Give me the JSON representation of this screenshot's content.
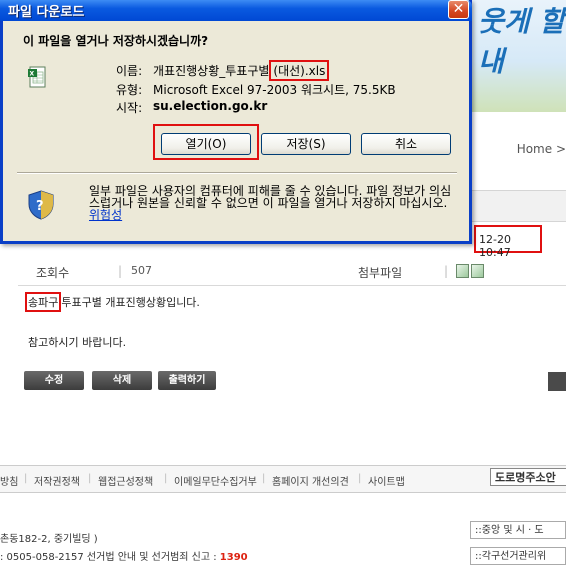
{
  "dialog": {
    "title": "파일 다운로드",
    "question": "이 파일을 열거나 저장하시겠습니까?",
    "name_label": "이름:",
    "name_value_prefix": "개표진행상황_투표구별",
    "name_value_highlight": "(대선)",
    "name_value_suffix": ".xls",
    "type_label": "유형:",
    "type_value": "Microsoft Excel 97-2003 워크시트, 75.5KB",
    "from_label": "시작:",
    "from_value": "su.election.go.kr",
    "buttons": {
      "open": "열기(O)",
      "save": "저장(S)",
      "cancel": "취소"
    },
    "warning_text": "일부 파일은 사용자의 컴퓨터에 피해를 줄 수 있습니다. 파일 정보가 의심스럽거나 원본을 신뢰할 수 없으면 이 파일을 열거나 저장하지 마십시오.",
    "warning_link": "위험성",
    "close_symbol": "✕"
  },
  "page": {
    "slogan": "웃게 할내",
    "home": "Home >",
    "gray_band_text": "",
    "date_text": "12-20 10:47",
    "views_label": "조회수",
    "views_value": "507",
    "attach_label": "첨부파일",
    "content_highlight": "송파구",
    "content_rest": "투표구별 개표진행상황입니다.",
    "content_line2": "참고하시기 바랍니다.",
    "buttons": {
      "edit": "수정",
      "delete": "삭제",
      "print": "출력하기"
    },
    "footer_links": [
      "방침",
      "저작권정책",
      "웹접근성정책",
      "이메일무단수집거부",
      "홈페이지 개선의견",
      "사이트맵"
    ],
    "road_address": "도로명주소안",
    "address": "촌동182-2, 중기빌딩 )",
    "tel_prefix": ": 0505-058-2157  선거법 안내 및 선거범죄 신고 :",
    "tel_highlight": "1390",
    "box1": "::중앙 및 시 · 도",
    "box2": "::각구선거관리위"
  },
  "colors": {
    "highlight_red": "#e01010",
    "titlebar_blue": "#0048d4",
    "dialog_bg": "#ece9d8",
    "link_blue": "#0033cc"
  },
  "icons": {
    "file_icon": "excel-file-icon",
    "shield_icon": "security-shield-icon",
    "close_icon": "close-icon"
  }
}
